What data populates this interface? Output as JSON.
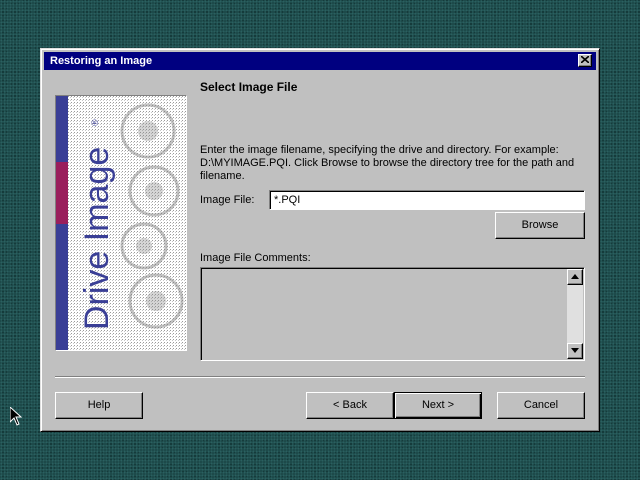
{
  "dialog": {
    "title": "Restoring an Image",
    "close_icon": "close-x-icon"
  },
  "side_image": {
    "brand_text": "Drive Image",
    "trademark": "®",
    "colors": {
      "blue": "#3a3f96",
      "magenta": "#9a1f5c",
      "brand_text": "#3a3f96"
    }
  },
  "page": {
    "heading": "Select Image File",
    "description_line1": "Enter the image filename, specifying the drive and directory.  For example:",
    "description_line2": "D:\\MYIMAGE.PQI.  Click Browse to browse the directory tree for the path and",
    "description_line3": "filename."
  },
  "image_file": {
    "label": "Image File:",
    "value": "*.PQI"
  },
  "browse_button": {
    "label": "Browse"
  },
  "comments": {
    "label": "Image File Comments:",
    "value": "",
    "scroll_up_icon": "scroll-up-arrow-icon",
    "scroll_down_icon": "scroll-down-arrow-icon"
  },
  "footer": {
    "help_label": "Help",
    "back_label": "< Back",
    "next_label": "Next >",
    "cancel_label": "Cancel"
  },
  "colors": {
    "desktop": "#1d4a4a",
    "title_bar": "#000080",
    "face": "#c0c0c0"
  }
}
